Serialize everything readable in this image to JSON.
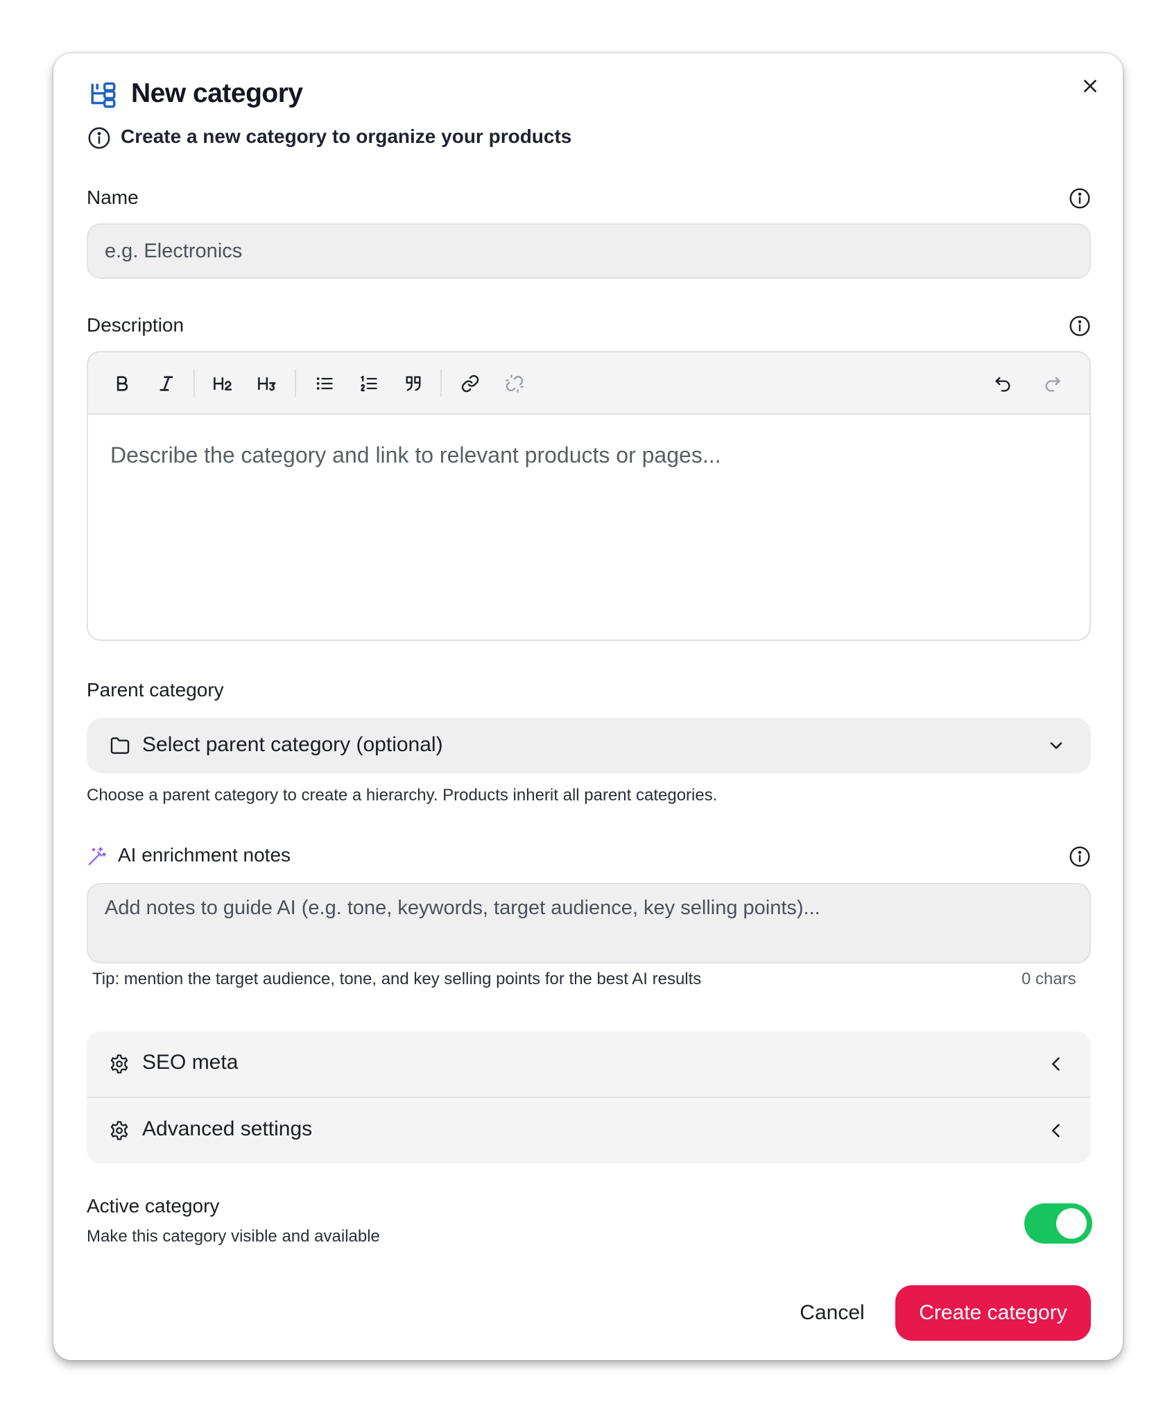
{
  "dialog": {
    "title": "New category",
    "subtitle": "Create a new category to organize your products"
  },
  "name": {
    "label": "Name",
    "placeholder": "e.g. Electronics",
    "value": ""
  },
  "description": {
    "label": "Description",
    "placeholder": "Describe the category and link to relevant products or pages...",
    "toolbar": [
      "bold",
      "italic",
      "heading-2",
      "heading-3",
      "bullet-list",
      "ordered-list",
      "blockquote",
      "link",
      "unlink",
      "undo",
      "redo"
    ]
  },
  "parent": {
    "label": "Parent category",
    "selected": "Select parent category (optional)",
    "help": "Choose a parent category to create a hierarchy. Products inherit all parent categories."
  },
  "ai_notes": {
    "label": "AI enrichment notes",
    "placeholder": "Add notes to guide AI (e.g. tone, keywords, target audience, key selling points)...",
    "tip": "Tip: mention the target audience, tone, and key selling points for the best AI results",
    "char_count": "0 chars"
  },
  "sections": [
    {
      "label": "SEO meta"
    },
    {
      "label": "Advanced settings"
    }
  ],
  "active": {
    "label": "Active category",
    "help": "Make this category visible and available",
    "enabled": true
  },
  "actions": {
    "cancel": "Cancel",
    "create": "Create category"
  },
  "colors": {
    "accent": "#e8174c",
    "toggle_on": "#17c45e",
    "title_icon": "#1f63c7",
    "ai_icon": "#8a5cf6"
  }
}
